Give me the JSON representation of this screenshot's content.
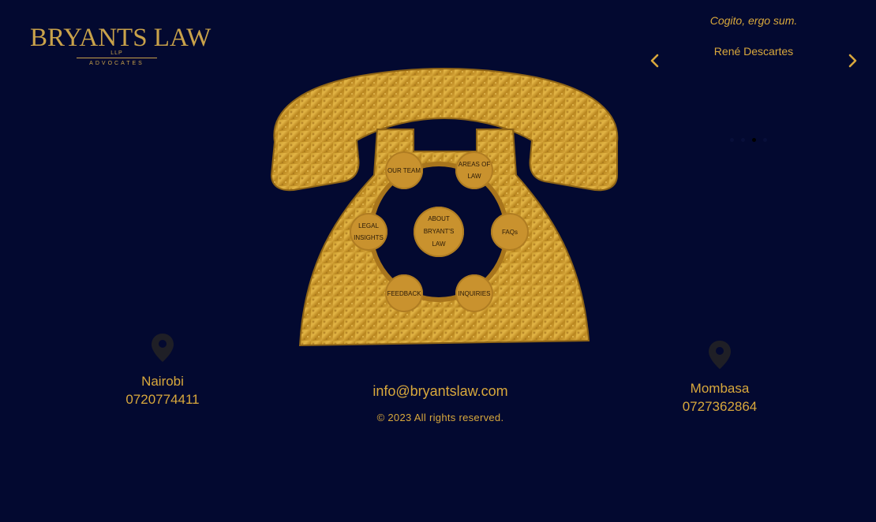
{
  "logo": {
    "name": "BRYANTS LAW",
    "llp": "LLP",
    "subtitle": "ADVOCATES"
  },
  "quote": {
    "text": "Cogito, ergo sum.",
    "author": "René Descartes"
  },
  "carousel": {
    "dot_count": 4,
    "active_index": 2
  },
  "dial": {
    "center": "ABOUT BRYANT'S LAW",
    "items": [
      {
        "id": "our-team",
        "label": "OUR TEAM"
      },
      {
        "id": "areas-of-law",
        "label": "AREAS OF LAW"
      },
      {
        "id": "legal-insights",
        "label": "LEGAL INSIGHTS"
      },
      {
        "id": "faqs",
        "label": "FAQs"
      },
      {
        "id": "feedback",
        "label": "FEEDBACK"
      },
      {
        "id": "inquiries",
        "label": "INQUIRIES"
      }
    ]
  },
  "locations": [
    {
      "city": "Nairobi",
      "phone": "0720774411"
    },
    {
      "city": "Mombasa",
      "phone": "0727362864"
    }
  ],
  "contact": {
    "email": "info@bryantslaw.com",
    "copyright": "© 2023 All rights reserved."
  },
  "colors": {
    "background": "#030930",
    "gold": "#d8a83c",
    "pin": "#1f1f26"
  },
  "icons": {
    "prev": "chevron-left-icon",
    "next": "chevron-right-icon",
    "location": "map-pin-icon"
  }
}
